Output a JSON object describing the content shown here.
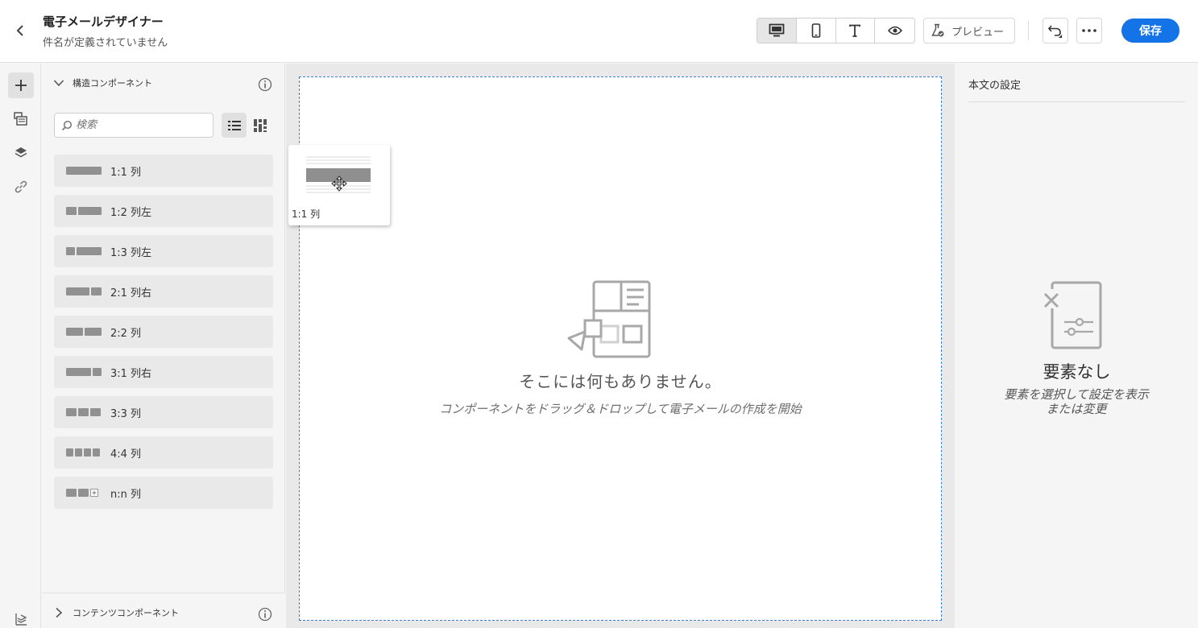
{
  "header": {
    "title": "電子メールデザイナー",
    "subtitle": "件名が定義されていません",
    "preview_label": "プレビュー",
    "save_label": "保存"
  },
  "components_panel": {
    "section_title": "構造コンポーネント",
    "search_placeholder": "検索",
    "items": [
      {
        "label": "1:1 列"
      },
      {
        "label": "1:2 列左"
      },
      {
        "label": "1:3 列左"
      },
      {
        "label": "2:1 列右"
      },
      {
        "label": "2:2 列"
      },
      {
        "label": "3:1 列右"
      },
      {
        "label": "3:3 列"
      },
      {
        "label": "4:4 列"
      },
      {
        "label": "n:n 列"
      }
    ],
    "footer_section_title": "コンテンツコンポーネント"
  },
  "canvas": {
    "empty_title": "そこには何もありません。",
    "empty_subtitle": "コンポーネントをドラッグ＆ドロップして電子メールの作成を開始",
    "drag_card_label": "1:1 列"
  },
  "right_panel": {
    "title": "本文の設定",
    "empty_title": "要素なし",
    "empty_subtitle": "要素を選択して設定を表示または変更"
  },
  "colors": {
    "accent": "#1473e6",
    "canvas_border": "#3b7bd8",
    "icon_gray": "#919191"
  }
}
